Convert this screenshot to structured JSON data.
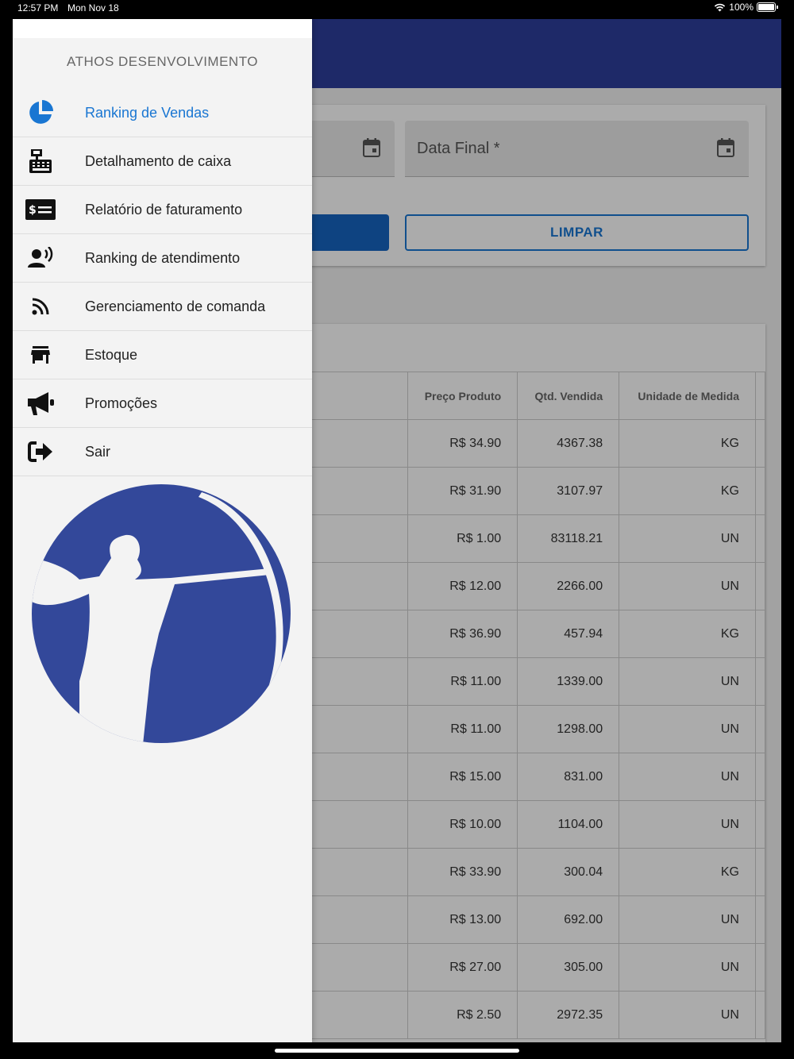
{
  "status_bar": {
    "time": "12:57 PM",
    "date": "Mon Nov 18",
    "battery": "100%"
  },
  "filters": {
    "start_date_label": "",
    "end_date_label": "Data Final *",
    "search_label": "",
    "clear_label": "LIMPAR"
  },
  "table": {
    "headers": {
      "name": "",
      "price": "Preço Produto",
      "qty": "Qtd. Vendida",
      "unit": "Unidade de Medida"
    },
    "rows": [
      {
        "name": "",
        "price": "R$ 34.90",
        "qty": "4367.38",
        "unit": "KG"
      },
      {
        "name": "",
        "price": "R$ 31.90",
        "qty": "3107.97",
        "unit": "KG"
      },
      {
        "name": "",
        "price": "R$ 1.00",
        "qty": "83118.21",
        "unit": "UN"
      },
      {
        "name": "",
        "price": "R$ 12.00",
        "qty": "2266.00",
        "unit": "UN"
      },
      {
        "name": "",
        "price": "R$ 36.90",
        "qty": "457.94",
        "unit": "KG"
      },
      {
        "name": "",
        "price": "R$ 11.00",
        "qty": "1339.00",
        "unit": "UN"
      },
      {
        "name": "",
        "price": "R$ 11.00",
        "qty": "1298.00",
        "unit": "UN"
      },
      {
        "name": "",
        "price": "R$ 15.00",
        "qty": "831.00",
        "unit": "UN"
      },
      {
        "name": "",
        "price": "R$ 10.00",
        "qty": "1104.00",
        "unit": "UN"
      },
      {
        "name": "",
        "price": "R$ 33.90",
        "qty": "300.04",
        "unit": "KG"
      },
      {
        "name": "",
        "price": "R$ 13.00",
        "qty": "692.00",
        "unit": "UN"
      },
      {
        "name": "",
        "price": "R$ 27.00",
        "qty": "305.00",
        "unit": "UN"
      },
      {
        "name": "",
        "price": "R$ 2.50",
        "qty": "2972.35",
        "unit": "UN"
      }
    ]
  },
  "drawer": {
    "title": "ATHOS DESENVOLVIMENTO",
    "items": [
      {
        "label": "Ranking de Vendas",
        "icon": "pie-chart-icon",
        "active": true
      },
      {
        "label": "Detalhamento de caixa",
        "icon": "cash-register-icon",
        "active": false
      },
      {
        "label": "Relatório de faturamento",
        "icon": "money-check-icon",
        "active": false
      },
      {
        "label": "Ranking de atendimento",
        "icon": "person-voice-icon",
        "active": false
      },
      {
        "label": "Gerenciamento de comanda",
        "icon": "rss-feed-icon",
        "active": false
      },
      {
        "label": "Estoque",
        "icon": "store-icon",
        "active": false
      },
      {
        "label": "Promoções",
        "icon": "megaphone-icon",
        "active": false
      },
      {
        "label": "Sair",
        "icon": "sign-out-icon",
        "active": false
      }
    ]
  },
  "colors": {
    "appbar": "#2d3e9c",
    "accent": "#1976d2",
    "logo": "#33489a"
  }
}
